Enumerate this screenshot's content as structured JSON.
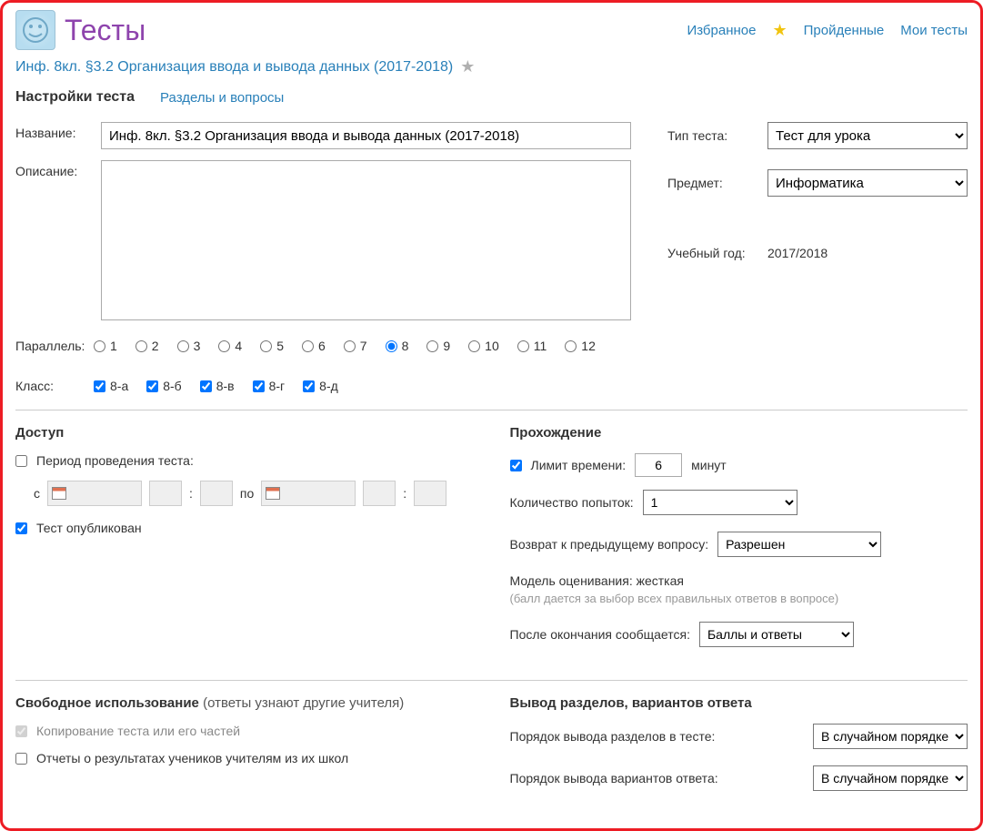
{
  "header": {
    "page_title": "Тесты",
    "links": {
      "favorites": "Избранное",
      "passed": "Пройденные",
      "my_tests": "Мои тесты"
    }
  },
  "breadcrumb": {
    "test_name": "Инф. 8кл. §3.2 Организация ввода и вывода данных (2017-2018)"
  },
  "tabs": {
    "settings": "Настройки теста",
    "sections": "Разделы и вопросы"
  },
  "form": {
    "name_label": "Название:",
    "name_value": "Инф. 8кл. §3.2 Организация ввода и вывода данных (2017-2018)",
    "description_label": "Описание:",
    "description_value": "",
    "parallel_label": "Параллель:",
    "parallels": [
      "1",
      "2",
      "3",
      "4",
      "5",
      "6",
      "7",
      "8",
      "9",
      "10",
      "11",
      "12"
    ],
    "parallel_selected": "8",
    "class_label": "Класс:",
    "classes": [
      "8-а",
      "8-б",
      "8-в",
      "8-г",
      "8-д"
    ]
  },
  "right_panel": {
    "test_type_label": "Тип теста:",
    "test_type_value": "Тест для урока",
    "subject_label": "Предмет:",
    "subject_value": "Информатика",
    "year_label": "Учебный год:",
    "year_value": "2017/2018"
  },
  "access": {
    "heading": "Доступ",
    "period_label": "Период проведения теста:",
    "from_label": "с",
    "to_label": "по",
    "published_label": "Тест опубликован"
  },
  "passing": {
    "heading": "Прохождение",
    "time_limit_label": "Лимит времени:",
    "time_limit_value": "6",
    "time_limit_unit": "минут",
    "attempts_label": "Количество попыток:",
    "attempts_value": "1",
    "back_label": "Возврат к предыдущему вопросу:",
    "back_value": "Разрешен",
    "model_label": "Модель оценивания: жесткая",
    "model_note": "(балл дается за выбор всех правильных ответов в вопросе)",
    "after_label": "После окончания сообщается:",
    "after_value": "Баллы и ответы"
  },
  "free_use": {
    "heading": "Свободное использование",
    "heading_sub": "(ответы узнают другие учителя)",
    "copy_label": "Копирование теста или его частей",
    "reports_label": "Отчеты о результатах учеников учителям из их школ"
  },
  "output": {
    "heading": "Вывод разделов, вариантов ответа",
    "sections_order_label": "Порядок вывода разделов в тесте:",
    "sections_order_value": "В случайном порядке",
    "answers_order_label": "Порядок вывода вариантов ответа:",
    "answers_order_value": "В случайном порядке"
  }
}
